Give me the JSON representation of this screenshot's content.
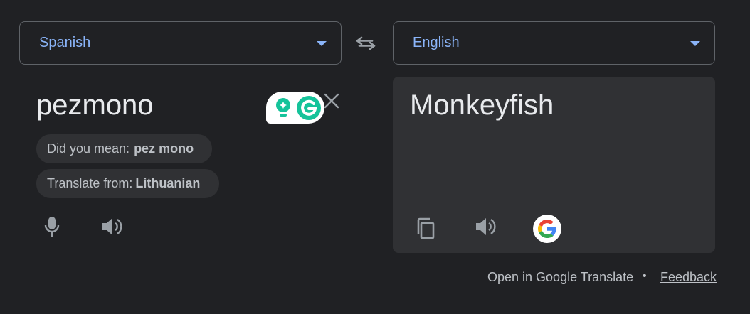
{
  "source": {
    "language": "Spanish",
    "text": "pezmono",
    "did_you_mean_label": "Did you mean:",
    "did_you_mean_value": "pez mono",
    "translate_from_label": "Translate from:",
    "translate_from_value": "Lithuanian"
  },
  "target": {
    "language": "English",
    "text": "Monkeyfish"
  },
  "footer": {
    "open_link": "Open in Google Translate",
    "separator": "•",
    "feedback": "Feedback"
  },
  "icons": {
    "swap": "swap-arrows-icon",
    "clear": "close-icon",
    "mic": "microphone-icon",
    "source_speaker": "speaker-icon",
    "copy": "copy-icon",
    "target_speaker": "speaker-icon",
    "google": "google-g-icon",
    "grammarly": "grammarly-icon"
  },
  "colors": {
    "background": "#202124",
    "panel": "#303134",
    "accent": "#8ab4f8",
    "grammarly_green": "#15c39a"
  }
}
